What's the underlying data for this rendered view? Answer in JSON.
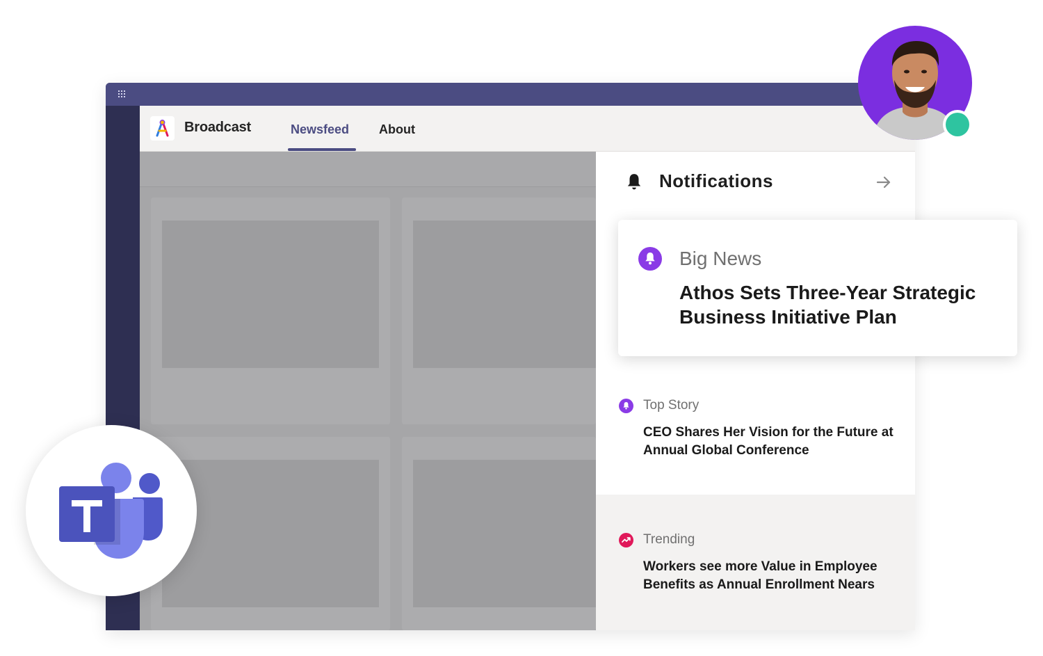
{
  "app": {
    "name": "Broadcast",
    "tabs": [
      {
        "label": "Newsfeed",
        "active": true
      },
      {
        "label": "About",
        "active": false
      }
    ]
  },
  "notifications": {
    "title": "Notifications",
    "featured": {
      "category": "Big News",
      "headline": "Athos Sets Three-Year Strategic Business Initiative Plan",
      "icon": "bell-icon",
      "color": "#8a3be6"
    },
    "items": [
      {
        "category": "Top Story",
        "headline": "CEO Shares Her Vision for the Future at Annual Global Conference",
        "icon": "bell-icon",
        "color": "#8a3be6"
      },
      {
        "category": "Trending",
        "headline": "Workers see more Value in Employee Benefits as Annual Enrollment Nears",
        "icon": "trending-icon",
        "color": "#e0195a"
      }
    ]
  },
  "user": {
    "presence": "available",
    "presence_color": "#2ec4a0",
    "avatar_bg": "#7b2ee0"
  },
  "colors": {
    "titlebar": "#4b4c82",
    "rail": "#2e2f52",
    "accent": "#4b4c82"
  }
}
